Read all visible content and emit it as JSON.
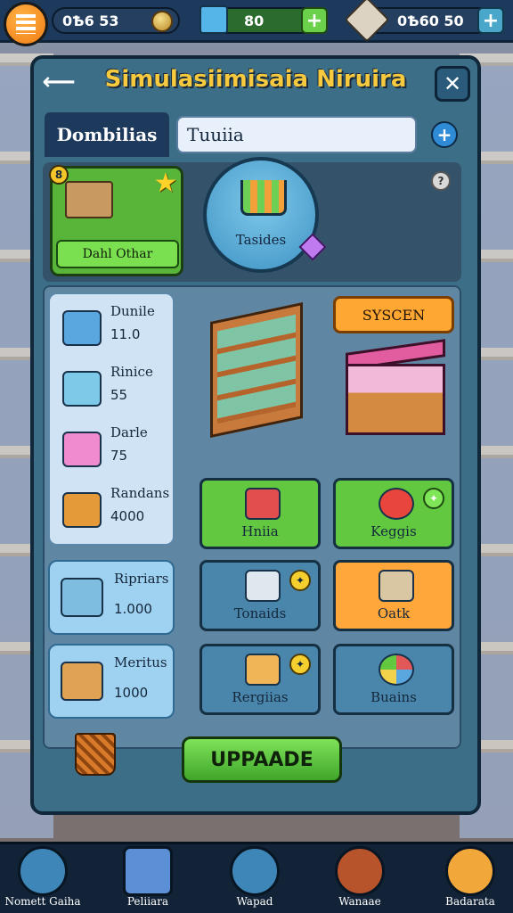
{
  "topbar": {
    "cash_value": "0Ѣ6 53",
    "gems_value": "80",
    "boxes_value": "0Ѣ60 50",
    "plus_label": "+"
  },
  "panel": {
    "title": "Simulasiimisaia Niruira",
    "back_label": "⟵",
    "close_label": "✕",
    "tab_active": "Dombilias",
    "tab_input_value": "Tuuiia",
    "tab_add_label": "+"
  },
  "hero": {
    "daily_badge": "8",
    "daily_button": "Dahl Othar",
    "cart_label": "Tasides",
    "info_label": "?"
  },
  "side_list": [
    {
      "name": "Dunile",
      "value": "11.0"
    },
    {
      "name": "Rinice",
      "value": "55"
    },
    {
      "name": "Darle",
      "value": "75"
    },
    {
      "name": "Randans",
      "value": "4000"
    }
  ],
  "big_cards": [
    {
      "name": "Ripriars",
      "value": "1.000"
    },
    {
      "name": "Meritus",
      "value": "1000"
    }
  ],
  "system_button": "SYSCEN",
  "tiles": [
    {
      "label": "Hniia",
      "badge": ""
    },
    {
      "label": "Keggis",
      "badge": "✦"
    },
    {
      "label": "Tonaids",
      "badge": "✦"
    },
    {
      "label": "Oatk",
      "badge": ""
    },
    {
      "label": "Rergiias",
      "badge": "✦"
    },
    {
      "label": "Buains",
      "badge": ""
    }
  ],
  "upgrade_button": "UPPAADE",
  "bottom_nav": [
    {
      "label": "Nomett Gaiha"
    },
    {
      "label": "Peliiara"
    },
    {
      "label": "Wapad"
    },
    {
      "label": "Wanaae"
    },
    {
      "label": "Badarata"
    }
  ],
  "colors": {
    "accent_gold": "#f6c93f",
    "green": "#62c840",
    "orange": "#ffa73a",
    "panel_blue": "#3d6e87"
  }
}
